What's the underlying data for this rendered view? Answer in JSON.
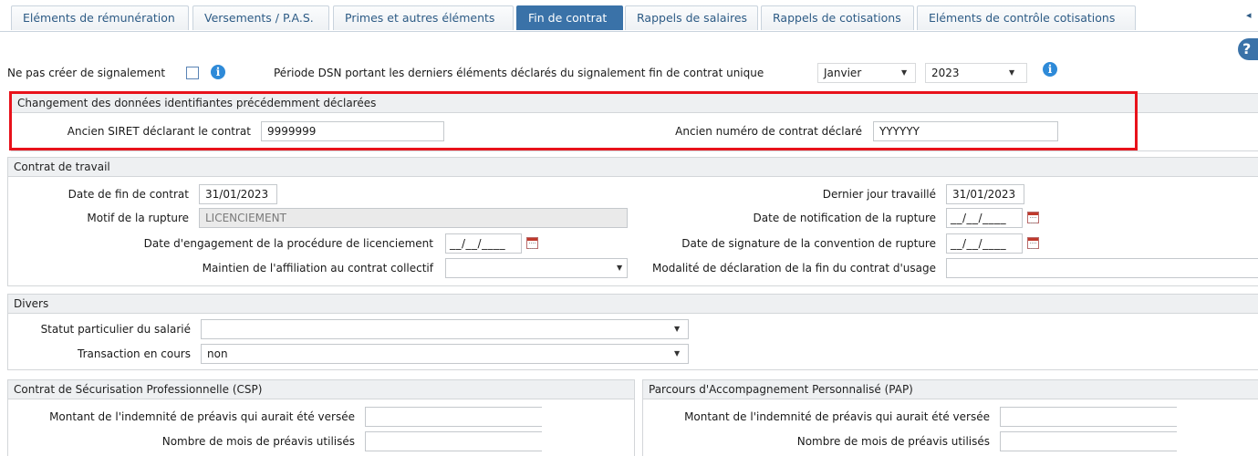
{
  "tabs": [
    {
      "label": "Eléments de rémunération",
      "active": false
    },
    {
      "label": "Versements / P.A.S.",
      "active": false
    },
    {
      "label": "Primes et autres éléments",
      "active": false
    },
    {
      "label": "Fin de contrat",
      "active": true
    },
    {
      "label": "Rappels de salaires",
      "active": false
    },
    {
      "label": "Rappels de cotisations",
      "active": false
    },
    {
      "label": "Eléments de contrôle cotisations",
      "active": false
    }
  ],
  "top": {
    "no_report_label": "Ne pas créer de signalement",
    "no_report_checked": false,
    "periode_label": "Période DSN portant les derniers éléments déclarés du signalement fin de contrat unique",
    "month_value": "Janvier",
    "year_value": "2023",
    "help_glyph": "?",
    "info_glyph": "i"
  },
  "identifiantes": {
    "title": "Changement des données identifiantes précédemment déclarées",
    "siret_label": "Ancien SIRET déclarant le contrat",
    "siret_value": "9999999",
    "numero_label": "Ancien numéro de contrat déclaré",
    "numero_value": "YYYYYY"
  },
  "contrat": {
    "title": "Contrat de travail",
    "date_fin_label": "Date de fin de contrat",
    "date_fin_value": "31/01/2023",
    "motif_label": "Motif de la rupture",
    "motif_value": "LICENCIEMENT",
    "engagement_label": "Date d'engagement de la procédure de licenciement",
    "engagement_value": "__/__/____",
    "maintien_label": "Maintien de l'affiliation au contrat collectif",
    "maintien_value": "",
    "dernier_jour_label": "Dernier jour travaillé",
    "dernier_jour_value": "31/01/2023",
    "notification_label": "Date de notification de la rupture",
    "notification_value": "__/__/____",
    "signature_label": "Date de signature de la convention de rupture",
    "signature_value": "__/__/____",
    "modalite_label": "Modalité de déclaration de la fin du contrat d'usage",
    "modalite_value": ""
  },
  "divers": {
    "title": "Divers",
    "statut_label": "Statut particulier du salarié",
    "statut_value": "",
    "transaction_label": "Transaction en cours",
    "transaction_value": "non"
  },
  "csp": {
    "title": "Contrat de Sécurisation Professionnelle (CSP)",
    "montant_label": "Montant de l'indemnité de préavis qui aurait été versée",
    "montant_value": "",
    "mois_label": "Nombre de mois de préavis utilisés",
    "mois_value": ""
  },
  "pap": {
    "title": "Parcours d'Accompagnement Personnalisé (PAP)",
    "montant_label": "Montant de l'indemnité de préavis qui aurait été versée",
    "montant_value": "",
    "mois_label": "Nombre de mois de préavis utilisés",
    "mois_value": ""
  },
  "colors": {
    "accent": "#3a72a8",
    "highlight": "#e8121b"
  }
}
